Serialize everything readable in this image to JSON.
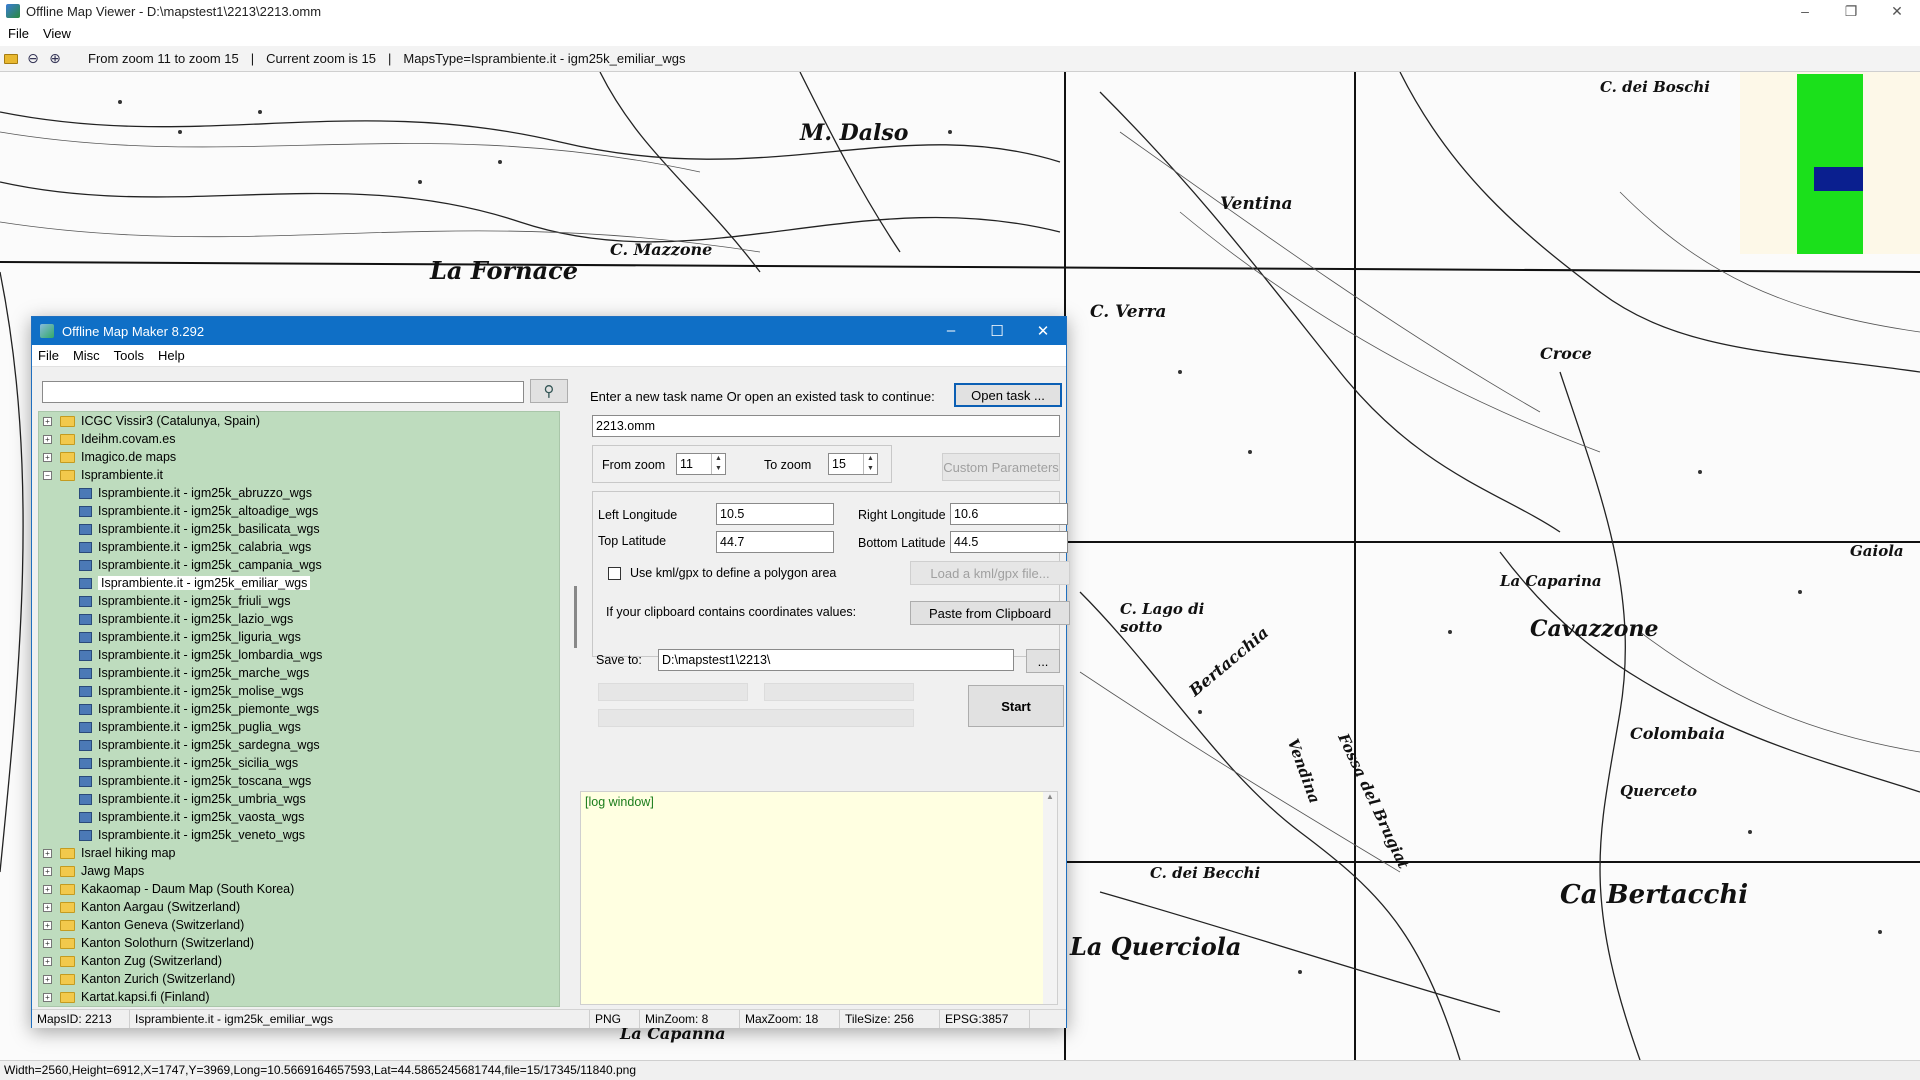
{
  "viewer": {
    "title": "Offline Map Viewer - D:\\mapstest1\\2213\\2213.omm",
    "menu": [
      "File",
      "View"
    ],
    "toolbar": {
      "zoom_range": "From zoom 11 to zoom 15",
      "sep1": "|",
      "current_zoom": "Current zoom is 15",
      "sep2": "|",
      "maps_type": "MapsType=Isprambiente.it - igm25k_emiliar_wgs"
    },
    "status": "Width=2560,Height=6912,X=1747,Y=3969,Long=10.5669164657593,Lat=44.5865245681744,file=15/17345/11840.png"
  },
  "map": {
    "labels": [
      "M. Dalso",
      "C. Mazzone",
      "La Fornace",
      "Ventina",
      "C. dei Boschi",
      "C. Verra",
      "Croce",
      "C. Lago di sotto",
      "Bertacchia",
      "La Caparina",
      "Cavazzone",
      "Colombaia",
      "Querceto",
      "C. dei Becchi",
      "Ca Bertacchi",
      "La Querciola",
      "La Capanna",
      "Vendina",
      "Fossa del Brugiat",
      "Gaiola"
    ],
    "minimap_colors": {
      "background": "#fdf8e8",
      "coverage": "#1be01b",
      "viewport": "#0a1f8f"
    }
  },
  "dialog": {
    "title": "Offline Map Maker 8.292",
    "menu": [
      "File",
      "Misc",
      "Tools",
      "Help"
    ],
    "search": {
      "value": "",
      "placeholder": ""
    },
    "tree": {
      "before": [
        "ICGC Vissir3 (Catalunya, Spain)",
        "Ideihm.covam.es",
        "Imagico.de maps"
      ],
      "expanded_folder": "Isprambiente.it",
      "children": [
        "Isprambiente.it - igm25k_abruzzo_wgs",
        "Isprambiente.it - igm25k_altoadige_wgs",
        "Isprambiente.it - igm25k_basilicata_wgs",
        "Isprambiente.it - igm25k_calabria_wgs",
        "Isprambiente.it - igm25k_campania_wgs",
        "Isprambiente.it - igm25k_emiliar_wgs",
        "Isprambiente.it - igm25k_friuli_wgs",
        "Isprambiente.it - igm25k_lazio_wgs",
        "Isprambiente.it - igm25k_liguria_wgs",
        "Isprambiente.it - igm25k_lombardia_wgs",
        "Isprambiente.it - igm25k_marche_wgs",
        "Isprambiente.it - igm25k_molise_wgs",
        "Isprambiente.it - igm25k_piemonte_wgs",
        "Isprambiente.it - igm25k_puglia_wgs",
        "Isprambiente.it - igm25k_sardegna_wgs",
        "Isprambiente.it - igm25k_sicilia_wgs",
        "Isprambiente.it - igm25k_toscana_wgs",
        "Isprambiente.it - igm25k_umbria_wgs",
        "Isprambiente.it - igm25k_vaosta_wgs",
        "Isprambiente.it - igm25k_veneto_wgs"
      ],
      "selected": "Isprambiente.it - igm25k_emiliar_wgs",
      "after": [
        "Israel hiking map",
        "Jawg Maps",
        "Kakaomap - Daum Map (South Korea)",
        "Kanton Aargau (Switzerland)",
        "Kanton Geneva (Switzerland)",
        "Kanton Solothurn (Switzerland)",
        "Kanton Zug (Switzerland)",
        "Kanton Zurich (Switzerland)",
        "Kartat.kapsi.fi (Finland)"
      ]
    },
    "task": {
      "prompt": "Enter a new task name Or open an existed task to continue:",
      "open_button": "Open task ...",
      "name": "2213.omm"
    },
    "zoom": {
      "from_label": "From zoom",
      "from_value": "11",
      "to_label": "To zoom",
      "to_value": "15",
      "custom_button": "Custom Parameters"
    },
    "coords": {
      "left_lon_label": "Left Longitude",
      "left_lon": "10.5",
      "right_lon_label": "Right Longitude",
      "right_lon": "10.6",
      "top_lat_label": "Top Latitude",
      "top_lat": "44.7",
      "bottom_lat_label": "Bottom Latitude",
      "bottom_lat": "44.5",
      "kml_label": "Use kml/gpx to define a polygon area",
      "kml_button": "Load a kml/gpx file...",
      "clipboard_label": "If your clipboard contains coordinates values:",
      "clipboard_button": "Paste from Clipboard"
    },
    "save": {
      "label": "Save to:",
      "path": "D:\\mapstest1\\2213\\",
      "browse": "..."
    },
    "start_button": "Start",
    "log": "[log window]",
    "status": {
      "maps_id": "MapsID: 2213",
      "map_name": "Isprambiente.it - igm25k_emiliar_wgs",
      "format": "PNG",
      "min_zoom": "MinZoom: 8",
      "max_zoom": "MaxZoom: 18",
      "tile_size": "TileSize: 256",
      "epsg": "EPSG:3857"
    }
  }
}
